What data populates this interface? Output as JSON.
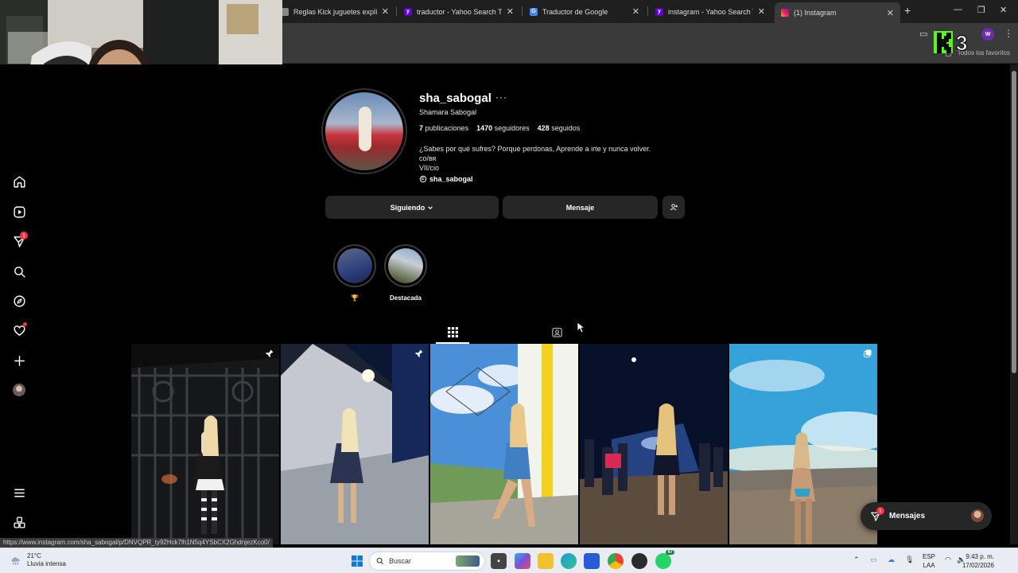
{
  "browser": {
    "tabs": [
      {
        "title": "Reglas Kick juguetes explícitos",
        "favicon": "doc"
      },
      {
        "title": "traductor - Yahoo Search Tus r",
        "favicon": "yahoo"
      },
      {
        "title": "Traductor de Google",
        "favicon": "translate"
      },
      {
        "title": "instagram - Yahoo Search Tus r",
        "favicon": "yahoo"
      },
      {
        "title": "(1) Instagram",
        "favicon": "instagram",
        "active": true
      }
    ],
    "bookmarks_label": "Todos los favoritos",
    "profile_initial": "W",
    "status_url": "https://www.instagram.com/sha_sabogal/p/DNVQPR_ty92Hck7lh1N5q4YSbCX2GhdnjezKco0/"
  },
  "overlay": {
    "brand": "K3"
  },
  "profile": {
    "username": "sha_sabogal",
    "more": "···",
    "full_name": "Shamara Sabogal",
    "stats": [
      {
        "count": "7",
        "label": "publicaciones"
      },
      {
        "count": "1470",
        "label": "seguidores"
      },
      {
        "count": "428",
        "label": "seguidos"
      }
    ],
    "bio_lines": [
      "¿Sabes por qué sufres? Porque perdonas, Aprende a irte y nunca volver.",
      "co/ʙʀ",
      "VII/cio"
    ],
    "threads_handle": "sha_sabogal",
    "buttons": {
      "following": "Siguiendo",
      "message": "Mensaje"
    }
  },
  "highlights": [
    {
      "label": "🏆"
    },
    {
      "label": "Destacada"
    }
  ],
  "posts": [
    {
      "pinned": true
    },
    {
      "pinned": true
    },
    {
      "pinned": false
    },
    {
      "pinned": false
    },
    {
      "multi": true
    }
  ],
  "sidebar": {
    "notification_count": "1"
  },
  "messages": {
    "label": "Mensajes",
    "badge": "1"
  },
  "taskbar": {
    "weather_temp": "21°C",
    "weather_desc": "Lluvia intensa",
    "search_placeholder": "Buscar",
    "whatsapp_badge": "47",
    "lang_top": "ESP",
    "lang_bottom": "LAA",
    "time": "9:43 p. m.",
    "date": "17/02/2026"
  },
  "colors": {
    "ig_background": "#000000",
    "button_bg": "#262626",
    "badge_red": "#ff3040",
    "taskbar_bg": "#e9edf3",
    "kick_green": "#53fc18"
  }
}
